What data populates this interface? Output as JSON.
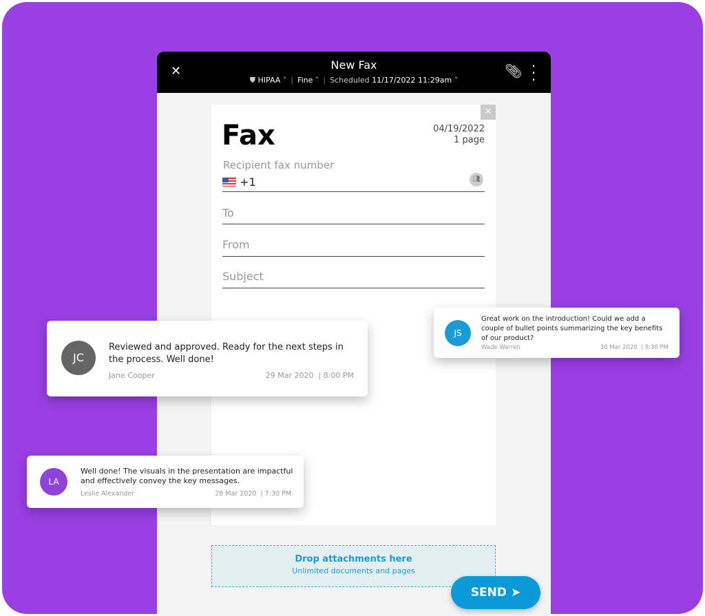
{
  "header": {
    "title": "New Fax",
    "security": "HIPAA",
    "quality": "Fine",
    "scheduled_label": "Scheduled",
    "scheduled_value": "11/17/2022 11:29am"
  },
  "fax": {
    "heading": "Fax",
    "date": "04/19/2022",
    "pages": "1 page",
    "recipient_label": "Recipient fax number",
    "country_code": "+1",
    "to_placeholder": "To",
    "from_placeholder": "From",
    "subject_placeholder": "Subject"
  },
  "drop": {
    "title": "Drop attachments here",
    "subtitle": "Unlimited documents and pages"
  },
  "send_label": "SEND",
  "comments": [
    {
      "initials": "JC",
      "text": "Reviewed and approved. Ready for the next steps in the process. Well done!",
      "author": "Jane Cooper",
      "date": "29 Mar 2020",
      "time": "8:00 PM",
      "color": "#656565"
    },
    {
      "initials": "JS",
      "text": "Great work on the introduction! Could we add a couple of bullet points summarizing the key benefits of our product?",
      "author": "Wade Warren",
      "date": "30 Mar 2020",
      "time": "9:30 PM",
      "color": "#1a9ad6"
    },
    {
      "initials": "LA",
      "text": "Well done! The visuals in the presentation are impactful and effectively convey the key messages.",
      "author": "Leslie Alexander",
      "date": "28 Mar 2020",
      "time": "7:30 PM",
      "color": "#8e44d9"
    }
  ],
  "colors": {
    "background": "#9a3fe3",
    "accent": "#0b9ad8"
  }
}
